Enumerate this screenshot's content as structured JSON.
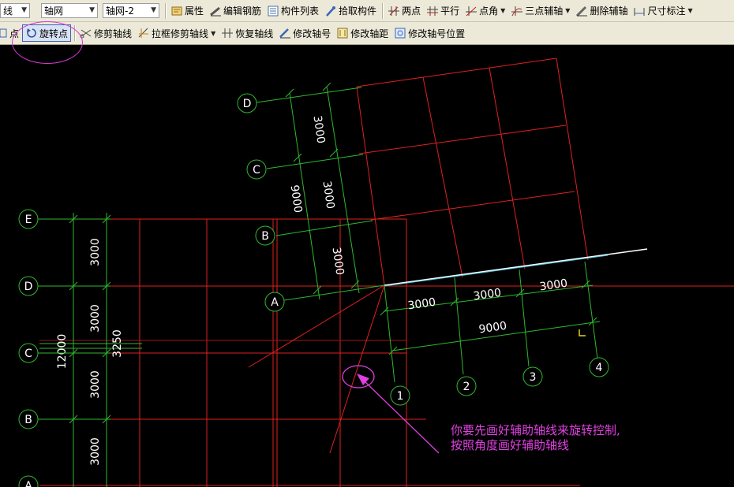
{
  "toolbar_top": {
    "combo_partial": "线",
    "combo_type": "轴网",
    "combo_name": "轴网-2",
    "buttons": [
      "属性",
      "编辑钢筋",
      "构件列表",
      "拾取构件",
      "两点",
      "平行",
      "点角",
      "三点辅轴",
      "删除辅轴",
      "尺寸标注"
    ]
  },
  "toolbar_second": {
    "point_label": "点",
    "rotate_point_label": "旋转点",
    "buttons": [
      "修剪轴线",
      "拉框修剪轴线",
      "恢复轴线",
      "修改轴号",
      "修改轴距",
      "修改轴号位置"
    ]
  },
  "grid_straight": {
    "axis_labels": [
      "E",
      "D",
      "C",
      "B",
      "A"
    ],
    "spacing_labels": [
      "3000",
      "3000",
      "3000",
      "3000"
    ],
    "total_label": "12000",
    "extra_label": "3250"
  },
  "grid_rotated": {
    "row_labels": [
      "D",
      "C",
      "B",
      "A"
    ],
    "col_labels": [
      "1",
      "2",
      "3",
      "4"
    ],
    "row_spacing_labels": [
      "3000",
      "3000",
      "3000"
    ],
    "row_total_label": "9000",
    "col_spacing_labels": [
      "3000",
      "3000",
      "3000"
    ],
    "col_total_label": "9000"
  },
  "annotation": {
    "line1": "你要先画好辅助轴线来旋转控制,",
    "line2": "按照角度画好辅助轴线"
  },
  "colors": {
    "background": "#000000",
    "axis_red": "#e02020",
    "dimension_green": "#2fb82f",
    "annotation_magenta": "#e040e0",
    "helper_line": "#ffffff"
  }
}
